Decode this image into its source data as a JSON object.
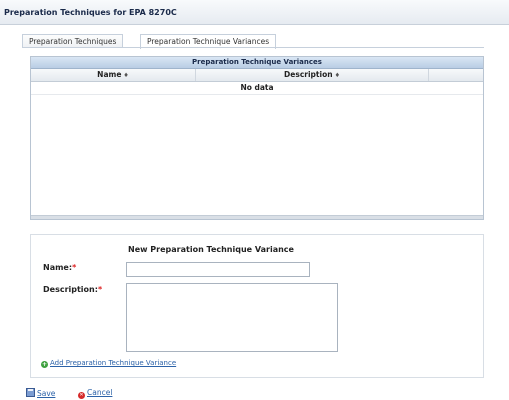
{
  "window": {
    "title": "Preparation Techniques for EPA 8270C"
  },
  "tabs": [
    {
      "label": "Preparation Techniques",
      "active": false
    },
    {
      "label": "Preparation Technique Variances",
      "active": true
    }
  ],
  "grid": {
    "caption": "Preparation Technique Variances",
    "columns": [
      {
        "label": "Name",
        "sort_icon": "sort-arrows-icon"
      },
      {
        "label": "Description",
        "sort_icon": "sort-arrows-icon"
      }
    ],
    "empty_text": "No data",
    "rows": []
  },
  "form": {
    "title": "New Preparation Technique Variance",
    "name_label": "Name:",
    "name_value": "",
    "description_label": "Description:",
    "description_value": "",
    "required_marker": "*",
    "add_link": "Add Preparation Technique Variance"
  },
  "footer": {
    "save": "Save",
    "cancel": "Cancel"
  },
  "colors": {
    "accent": "#2c62a8",
    "required": "#d22222",
    "grid_header": "#c8d9ec"
  }
}
